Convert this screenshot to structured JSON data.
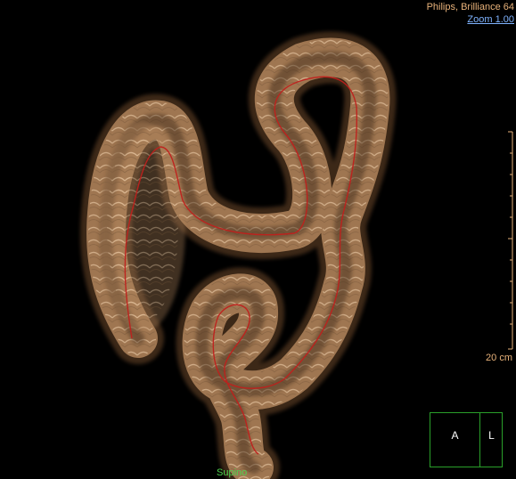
{
  "overlay": {
    "scanner": "Philips, Brilliance 64",
    "zoom": "Zoom 1.00",
    "scale": "20 cm",
    "position": "Supino"
  },
  "orientation_cube": {
    "front_label": "A",
    "side_label": "L"
  },
  "colors": {
    "background": "#000000",
    "tissue": "#c9a27a",
    "centerline": "#c0201c",
    "overlay_text": "#e8b27a",
    "zoom_link": "#7fb3ff",
    "position_text": "#4fd34f",
    "cube_border": "#2aa02a"
  }
}
